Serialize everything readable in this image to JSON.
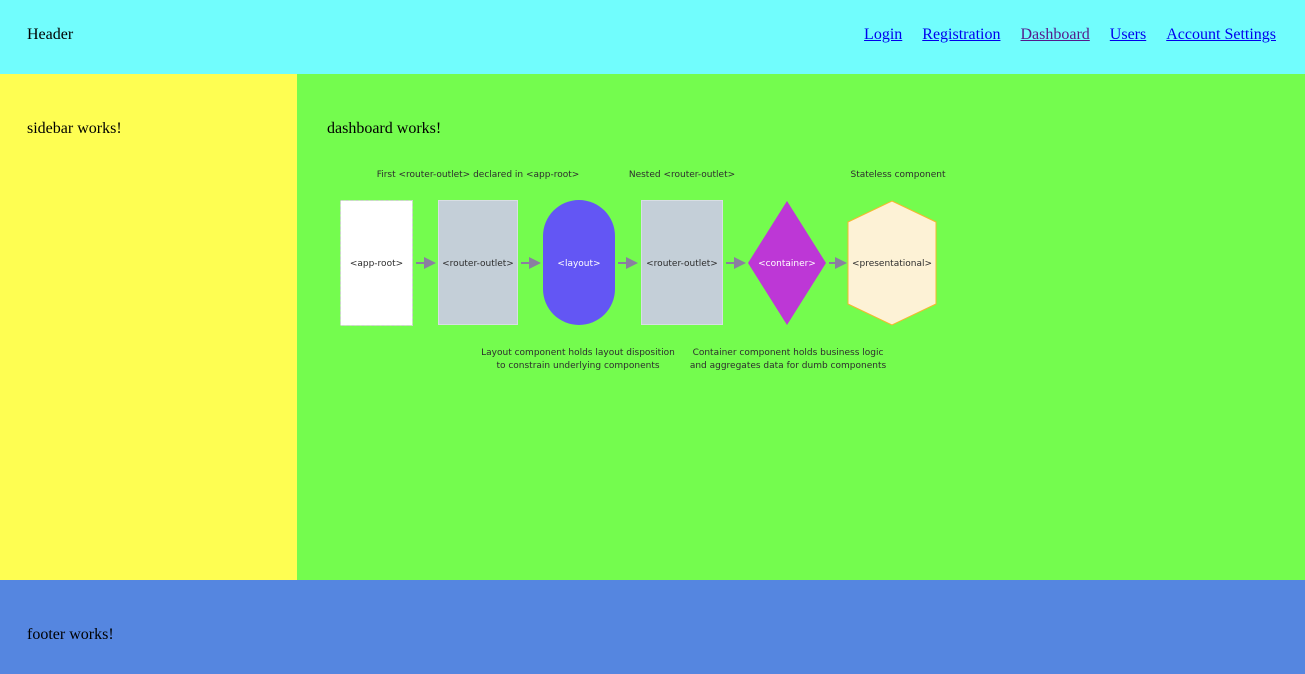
{
  "header": {
    "title": "Header",
    "nav": [
      {
        "label": "Login",
        "visited": false
      },
      {
        "label": "Registration",
        "visited": false
      },
      {
        "label": "Dashboard",
        "visited": true
      },
      {
        "label": "Users",
        "visited": false
      },
      {
        "label": "Account Settings",
        "visited": false
      }
    ]
  },
  "sidebar": {
    "text": "sidebar works!"
  },
  "main": {
    "text": "dashboard works!",
    "diagram": {
      "caption_first": "First <router-outlet> declared in <app-root>",
      "caption_nested": "Nested <router-outlet>",
      "caption_stateless": "Stateless component",
      "nodes": {
        "app_root": "<app-root>",
        "router_outlet_1": "<router-outlet>",
        "layout": "<layout>",
        "router_outlet_2": "<router-outlet>",
        "container": "<container>",
        "presentational": "<presentational>"
      },
      "note_layout_line1": "Layout component holds layout disposition",
      "note_layout_line2": "to constrain underlying components",
      "note_container_line1": "Container component holds business logic",
      "note_container_line2": "and aggregates data for dumb components"
    }
  },
  "footer": {
    "text": "footer works!"
  },
  "colors": {
    "header_bg": "#71fdfd",
    "sidebar_bg": "#fefe52",
    "main_bg": "#74fc4e",
    "footer_bg": "#5586e0",
    "layout_node": "#6356f4",
    "container_node": "#bd37d6",
    "presentational_node": "#fdf2d6",
    "router_outlet_node": "#c4cfd8"
  }
}
